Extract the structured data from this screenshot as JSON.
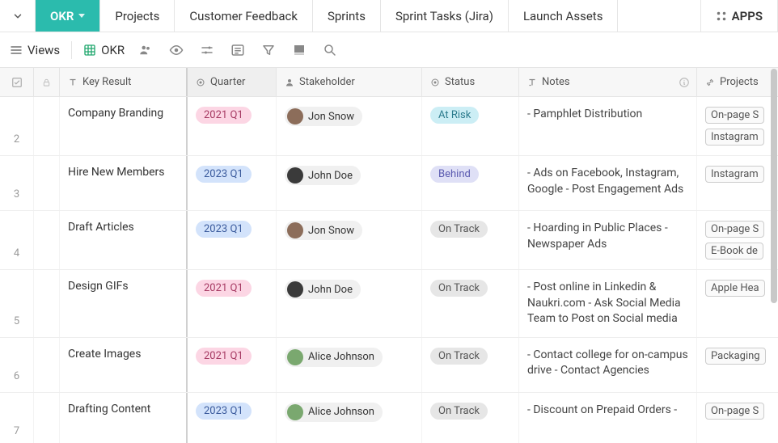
{
  "tabs": {
    "active": "OKR",
    "items": [
      "Projects",
      "Customer Feedback",
      "Sprints",
      "Sprint Tasks (Jira)",
      "Launch Assets"
    ],
    "apps": "APPS"
  },
  "toolbar": {
    "views": "Views",
    "okr": "OKR"
  },
  "columns": {
    "key": "Key Result",
    "quarter": "Quarter",
    "stakeholder": "Stakeholder",
    "status": "Status",
    "notes": "Notes",
    "projects": "Projects"
  },
  "quarter_styles": {
    "2021 Q1": "pill-pink",
    "2023 Q1": "pill-blue"
  },
  "status_styles": {
    "At Risk": "pill-atrisk",
    "Behind": "pill-behind",
    "On Track": "pill-track"
  },
  "rows": [
    {
      "n": "2",
      "key": "Company Branding",
      "quarter": "2021 Q1",
      "stakeholder": {
        "name": "Jon Snow",
        "avatar": "avatar-1"
      },
      "status": "At Risk",
      "notes": "- Pamphlet Distribution",
      "projects": [
        "On-page S",
        "Instagram"
      ]
    },
    {
      "n": "3",
      "key": "Hire New Members",
      "quarter": "2023 Q1",
      "stakeholder": {
        "name": "John Doe",
        "avatar": "avatar-2"
      },
      "status": "Behind",
      "notes": "- Ads on Facebook, Instagram, Google - Post Engagement Ads",
      "projects": [
        "Instagram"
      ]
    },
    {
      "n": "4",
      "key": "Draft Articles",
      "quarter": "2023 Q1",
      "stakeholder": {
        "name": "Jon Snow",
        "avatar": "avatar-1"
      },
      "status": "On Track",
      "notes": "- Hoarding in Public Places - Newspaper Ads",
      "projects": [
        "On-page S",
        "E-Book de"
      ]
    },
    {
      "n": "5",
      "key": "Design GIFs",
      "quarter": "2021 Q1",
      "stakeholder": {
        "name": "John Doe",
        "avatar": "avatar-2"
      },
      "status": "On Track",
      "notes": "- Post online in Linkedin & Naukri.com - Ask Social Media Team to Post on Social media",
      "projects": [
        "Apple Hea"
      ]
    },
    {
      "n": "6",
      "key": "Create Images",
      "quarter": "2021 Q1",
      "stakeholder": {
        "name": "Alice Johnson",
        "avatar": "avatar-3"
      },
      "status": "On Track",
      "notes": "- Contact college for on-campus drive - Contact Agencies",
      "projects": [
        "Packaging"
      ]
    },
    {
      "n": "7",
      "key": "Drafting Content",
      "quarter": "2023 Q1",
      "stakeholder": {
        "name": "Alice Johnson",
        "avatar": "avatar-3"
      },
      "status": "On Track",
      "notes": "- Discount on Prepaid Orders -",
      "projects": [
        "On-page S"
      ]
    }
  ]
}
